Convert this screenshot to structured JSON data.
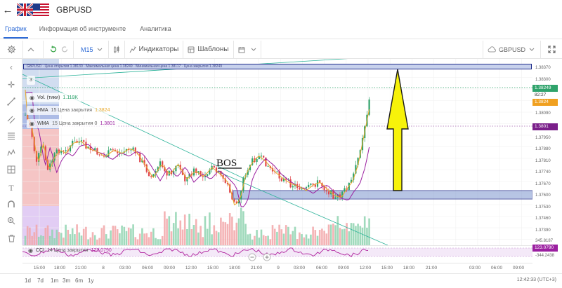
{
  "header": {
    "back_icon": "back-arrow-icon",
    "flag_icon": "uk-us-flag-icon",
    "title": "GBPUSD"
  },
  "tabs": [
    {
      "label": "График",
      "active": true
    },
    {
      "label": "Информация об инструменте",
      "active": false
    },
    {
      "label": "Аналитика",
      "active": false
    }
  ],
  "toolbar": {
    "timeframe": "M15",
    "indicators_label": "Индикаторы",
    "templates_label": "Шаблоны",
    "symbol": "GBPUSD",
    "icons": [
      "settings-icon",
      "chevron-up-icon",
      "undo-icon",
      "redo-icon",
      "candle-type-icon",
      "indicators-icon",
      "templates-icon",
      "calendar-icon",
      "cloud-save-icon",
      "fullscreen-icon"
    ]
  },
  "overlay": {
    "ohlc_strip": "GBPUSD · Цена открытия 1.38130 · Максимальная цена 1.38249 · Минимальная цена 1.38117 · Цена закрытия 1.38249",
    "count_badge": "3",
    "vol_name": "Vol. (тики)",
    "vol_value": "1.119K",
    "hma_name": "HMA",
    "hma_params": "15 Цена закрытия",
    "hma_value": "1.3824",
    "wma_name": "WMA",
    "wma_params": "15 Цена закрытия 0",
    "wma_value": "1.3801",
    "bos_label": "BOS"
  },
  "price_axis": {
    "ticks": [
      "1.38370",
      "1.38300",
      "1.38249",
      "82:27",
      "1.3824",
      "1.38090",
      "1.3801",
      "1.37950",
      "1.37880",
      "1.37810",
      "1.37740",
      "1.37670",
      "1.37600",
      "1.37530",
      "1.37460",
      "1.37390"
    ],
    "tick_labels": [
      "1.38370",
      "1.38300",
      "1.38090",
      "1.37950",
      "1.37880",
      "1.37810",
      "1.37740",
      "1.37670",
      "1.37600",
      "1.37530",
      "1.37460",
      "1.37390"
    ],
    "current_price": "1.38249",
    "countdown": "82:27",
    "hma_tag": "1.3824",
    "wma_tag": "1.3801",
    "colors": {
      "current": "#2fa36b",
      "countdown": "#2f2f2f",
      "hma": "#f0a020",
      "wma": "#7a1f8a"
    }
  },
  "cci": {
    "name": "CCI",
    "params": "14 Цена закрытия",
    "value": "123.0790",
    "axis_top": "345.8187",
    "axis_bottom": "-344.2438",
    "tag": "123.0790"
  },
  "time_axis": [
    "15:00",
    "18:00",
    "21:00",
    "8",
    "03:00",
    "06:00",
    "09:00",
    "12:00",
    "15:00",
    "18:00",
    "21:00",
    "9",
    "03:00",
    "06:00",
    "09:00",
    "12:00",
    "15:00",
    "18:00",
    "21:00",
    "03:00",
    "06:00",
    "09:00"
  ],
  "footer": {
    "ranges": [
      "1d",
      "7d",
      "1m",
      "3m",
      "6m",
      "1y"
    ],
    "clock": "12:42:33 (UTC+3)"
  }
}
